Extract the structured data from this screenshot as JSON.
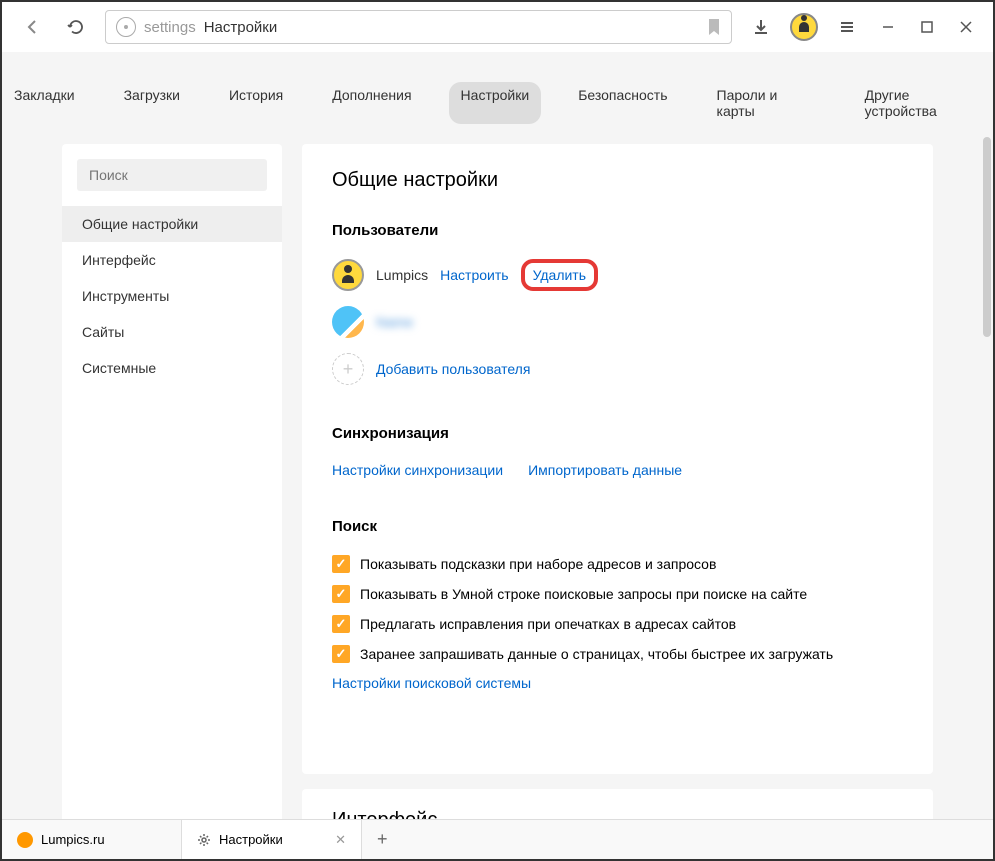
{
  "toolbar": {
    "addr_prefix": "settings",
    "addr_label": "Настройки"
  },
  "nav": {
    "items": [
      "Закладки",
      "Загрузки",
      "История",
      "Дополнения",
      "Настройки",
      "Безопасность",
      "Пароли и карты",
      "Другие устройства"
    ]
  },
  "sidebar": {
    "search_placeholder": "Поиск",
    "items": [
      "Общие настройки",
      "Интерфейс",
      "Инструменты",
      "Сайты",
      "Системные"
    ]
  },
  "main": {
    "title": "Общие настройки",
    "users": {
      "title": "Пользователи",
      "profile_name": "Lumpics",
      "configure": "Настроить",
      "delete": "Удалить",
      "blurred": "Name",
      "add": "Добавить пользователя"
    },
    "sync": {
      "title": "Синхронизация",
      "settings": "Настройки синхронизации",
      "import": "Импортировать данные"
    },
    "search": {
      "title": "Поиск",
      "opt1": "Показывать подсказки при наборе адресов и запросов",
      "opt2": "Показывать в Умной строке поисковые запросы при поиске на сайте",
      "opt3": "Предлагать исправления при опечатках в адресах сайтов",
      "opt4": "Заранее запрашивать данные о страницах, чтобы быстрее их загружать",
      "engine": "Настройки поисковой системы"
    },
    "next": "Интерфейс"
  },
  "tabs": {
    "t1": "Lumpics.ru",
    "t2": "Настройки"
  }
}
